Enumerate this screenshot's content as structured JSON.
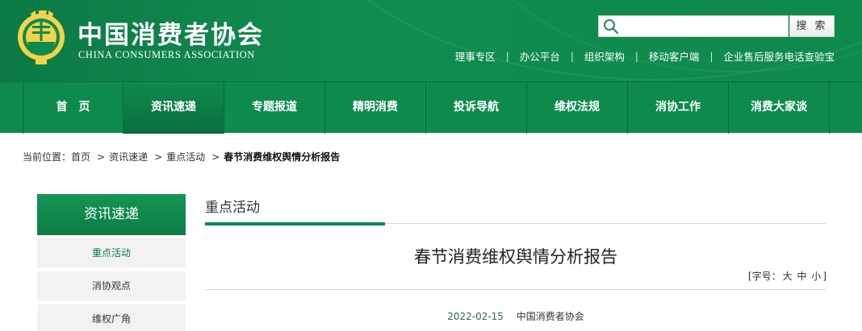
{
  "header": {
    "logo_cn": "中国消费者协会",
    "logo_en": "CHINA CONSUMERS ASSOCIATION",
    "search_placeholder": "",
    "search_button": "搜 索",
    "links": [
      "理事专区",
      "办公平台",
      "组织架构",
      "移动客户端",
      "企业售后服务电话查验宝"
    ],
    "link_separator": "|"
  },
  "nav": {
    "items": [
      "首　页",
      "资讯速递",
      "专题报道",
      "精明消费",
      "投诉导航",
      "维权法规",
      "消协工作",
      "消费大家谈"
    ],
    "active_index": 1
  },
  "breadcrumb": {
    "label": "当前位置：",
    "items": [
      "首页",
      "资讯速递",
      "重点活动"
    ],
    "current": "春节消费维权舆情分析报告",
    "arrow": ">"
  },
  "sidebar": {
    "title": "资讯速递",
    "items": [
      "重点活动",
      "消协观点",
      "维权广角"
    ]
  },
  "main": {
    "section_title": "重点活动",
    "article_title": "春节消费维权舆情分析报告",
    "font_size_label": "[字号：",
    "font_sizes": [
      "大",
      "中",
      "小"
    ],
    "font_size_end": "]",
    "date": "2022-02-15",
    "source": "中国消费者协会"
  },
  "colors": {
    "brand_green": "#0f8a4d",
    "brand_dark": "#0a6e3e",
    "sidebar_bg": "#f2f2f2"
  }
}
